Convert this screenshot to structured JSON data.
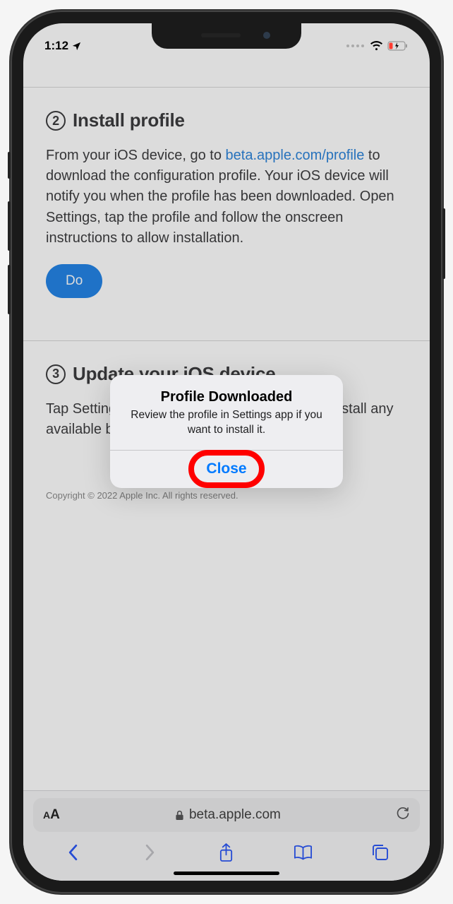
{
  "status_bar": {
    "time": "1:12"
  },
  "page": {
    "step2": {
      "number": "2",
      "title": "Install profile",
      "text_before_link": "From your iOS device, go to ",
      "link_text": "beta.apple.com/profile",
      "text_after_link": " to download the configuration profile. Your iOS device will notify you when the profile has been downloaded. Open Settings, tap the profile and follow the onscreen instructions to allow installation.",
      "download_label_partial": "Do"
    },
    "step3": {
      "number": "3",
      "title": "Update your iOS device",
      "text": "Tap Settings > General > Software Update to install any available beta software."
    },
    "copyright": "Copyright © 2022 Apple Inc. All rights reserved."
  },
  "alert": {
    "title": "Profile Downloaded",
    "message": "Review the profile in Settings app if you want to install it.",
    "close_label": "Close"
  },
  "browser": {
    "domain": "beta.apple.com"
  }
}
